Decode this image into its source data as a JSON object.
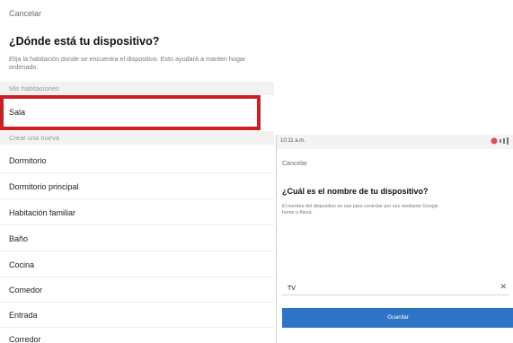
{
  "left_screen": {
    "cancel_label": "Cancelar",
    "title": "¿Dónde está tu dispositivo?",
    "description": "Elija la habitación donde se encuentra el dispositivo. Esto ayudará a manten hogar ordenado.",
    "my_rooms_section": "Mis habitaciones",
    "my_rooms": [
      "Sala"
    ],
    "create_new_section": "Crear una nueva",
    "new_rooms": [
      "Dormitorio",
      "Dormitorio principal",
      "Habitación familiar",
      "Baño",
      "Cocina",
      "Comedor",
      "Entrada",
      "Corredor"
    ],
    "highlight_color": "#cc1f24"
  },
  "right_screen": {
    "status_time": "10:11 a.m.",
    "cancel_label": "Cancelar",
    "title": "¿Cuál es el nombre de tu dispositivo?",
    "description": "El nombre del dispositivo se usa para controlar por voz mediante Google home o Alexa.",
    "device_name_value": "TV",
    "clear_icon": "close-icon",
    "save_label": "Guardar",
    "accent_color": "#2d74c4"
  }
}
